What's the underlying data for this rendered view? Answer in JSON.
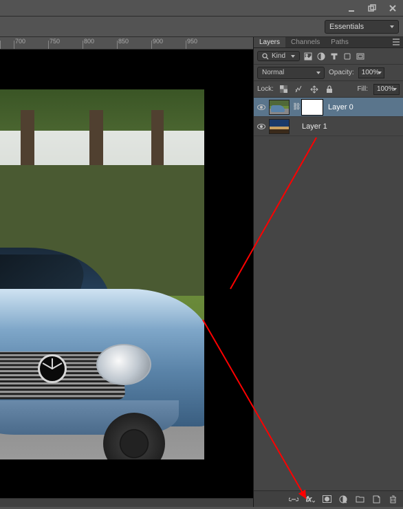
{
  "workspace": {
    "selected": "Essentials"
  },
  "ruler": {
    "marks": [
      "700",
      "750",
      "800",
      "850",
      "900",
      "950"
    ]
  },
  "panels": {
    "tabs": {
      "layers": "Layers",
      "channels": "Channels",
      "paths": "Paths",
      "active": "layers"
    },
    "filter": {
      "label": "Kind"
    },
    "blend": {
      "mode": "Normal",
      "opacity_label": "Opacity:",
      "opacity_value": "100%"
    },
    "lock": {
      "label": "Lock:",
      "fill_label": "Fill:",
      "fill_value": "100%"
    },
    "layers": [
      {
        "name": "Layer 0",
        "has_mask": true,
        "selected": true
      },
      {
        "name": "Layer 1",
        "has_mask": false,
        "selected": false
      }
    ]
  }
}
